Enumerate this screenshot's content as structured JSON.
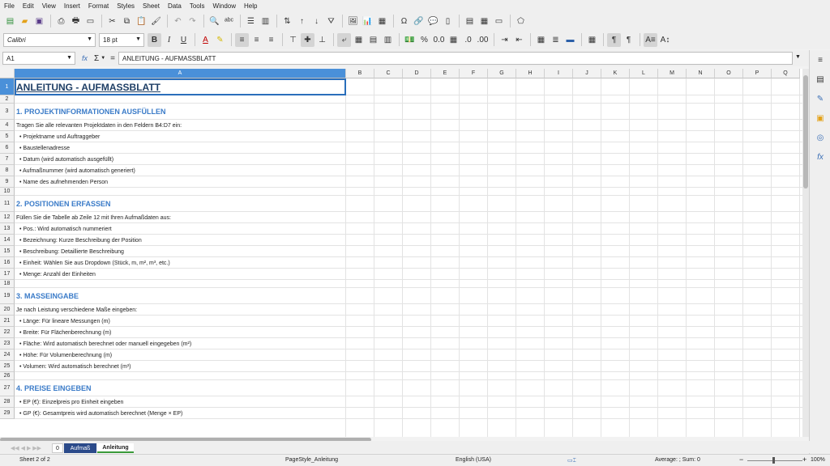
{
  "menu": [
    "File",
    "Edit",
    "View",
    "Insert",
    "Format",
    "Styles",
    "Sheet",
    "Data",
    "Tools",
    "Window",
    "Help"
  ],
  "font": {
    "name": "Calibri",
    "size": "18 pt"
  },
  "namebox": "A1",
  "formula_text": "ANLEITUNG - AUFMASSBLATT",
  "formula_symbols": {
    "fx": "fx",
    "sum": "Σ",
    "eq": "="
  },
  "columns": [
    "A",
    "B",
    "C",
    "D",
    "E",
    "F",
    "G",
    "H",
    "I",
    "J",
    "K",
    "L",
    "M",
    "N",
    "O",
    "P",
    "Q"
  ],
  "rows": [
    {
      "num": "1",
      "text": "ANLEITUNG - AUFMASSBLATT",
      "style": "title"
    },
    {
      "num": "2",
      "text": "",
      "style": ""
    },
    {
      "num": "3",
      "text": "1. PROJEKTINFORMATIONEN AUSFÜLLEN",
      "style": "h"
    },
    {
      "num": "4",
      "text": "Tragen Sie alle relevanten Projektdaten in den Feldern B4:D7 ein:",
      "style": ""
    },
    {
      "num": "5",
      "text": "• Projektname und Auftraggeber",
      "style": "bullet"
    },
    {
      "num": "6",
      "text": "• Baustellenadresse",
      "style": "bullet"
    },
    {
      "num": "7",
      "text": "• Datum (wird automatisch ausgefüllt)",
      "style": "bullet"
    },
    {
      "num": "8",
      "text": "• Aufmaßnummer (wird automatisch generiert)",
      "style": "bullet"
    },
    {
      "num": "9",
      "text": "• Name des aufnehmenden Person",
      "style": "bullet"
    },
    {
      "num": "10",
      "text": "",
      "style": ""
    },
    {
      "num": "11",
      "text": "2. POSITIONEN ERFASSEN",
      "style": "h"
    },
    {
      "num": "12",
      "text": "Füllen Sie die Tabelle ab Zeile 12 mit Ihren Aufmaßdaten aus:",
      "style": ""
    },
    {
      "num": "13",
      "text": "• Pos.: Wird automatisch nummeriert",
      "style": "bullet"
    },
    {
      "num": "14",
      "text": "• Bezeichnung: Kurze Beschreibung der Position",
      "style": "bullet"
    },
    {
      "num": "15",
      "text": "• Beschreibung: Detaillierte Beschreibung",
      "style": "bullet"
    },
    {
      "num": "16",
      "text": "• Einheit: Wählen Sie aus Dropdown (Stück, m, m², m³, etc.)",
      "style": "bullet"
    },
    {
      "num": "17",
      "text": "• Menge: Anzahl der Einheiten",
      "style": "bullet"
    },
    {
      "num": "18",
      "text": "",
      "style": ""
    },
    {
      "num": "19",
      "text": "3. MASSEINGABE",
      "style": "h"
    },
    {
      "num": "20",
      "text": "Je nach Leistung verschiedene Maße eingeben:",
      "style": ""
    },
    {
      "num": "21",
      "text": "• Länge: Für lineare Messungen (m)",
      "style": "bullet"
    },
    {
      "num": "22",
      "text": "• Breite: Für Flächenberechnung (m)",
      "style": "bullet"
    },
    {
      "num": "23",
      "text": "• Fläche: Wird automatisch berechnet oder manuell eingegeben (m²)",
      "style": "bullet"
    },
    {
      "num": "24",
      "text": "• Höhe: Für Volumenberechnung (m)",
      "style": "bullet"
    },
    {
      "num": "25",
      "text": "• Volumen: Wird automatisch berechnet (m³)",
      "style": "bullet"
    },
    {
      "num": "26",
      "text": "",
      "style": ""
    },
    {
      "num": "27",
      "text": "4. PREISE EINGEBEN",
      "style": "h"
    },
    {
      "num": "28",
      "text": "• EP (€): Einzelpreis pro Einheit eingeben",
      "style": "bullet"
    },
    {
      "num": "29",
      "text": "• GP (€): Gesamtpreis wird automatisch berechnet (Menge × EP)",
      "style": "bullet"
    }
  ],
  "tabs": [
    {
      "label": "0"
    },
    {
      "label": "Aufmaß"
    },
    {
      "label": "Anleitung"
    }
  ],
  "status": {
    "sheet": "Sheet 2 of 2",
    "pagestyle": "PageStyle_Anleitung",
    "language": "English (USA)",
    "summary": "Average: ; Sum: 0",
    "zoom": "100%"
  },
  "colors": {
    "selection": "#4a90d9",
    "heading": "#3a7bc8",
    "active_tab": "#2b4a8a"
  }
}
